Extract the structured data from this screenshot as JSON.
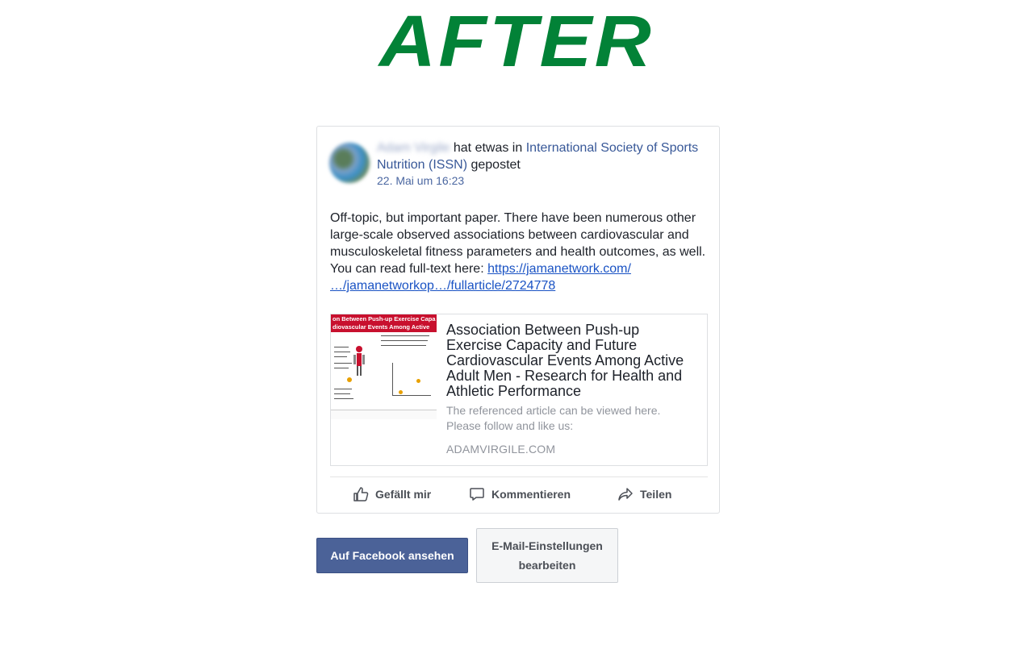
{
  "heading": "AFTER",
  "post": {
    "author_name": "Adam Virgile",
    "action_text": "hat etwas in",
    "group_name": "International Society of Sports Nutrition (ISSN)",
    "action_suffix": "gepostet",
    "timestamp": "22. Mai um 16:23",
    "body": "Off-topic, but important paper. There have been numerous other large-scale observed associations between cardiovascular and musculoskeletal fitness parameters and health outcomes, as well. You can read full-text here: ",
    "link_line1": "https://jamanetwork.com/",
    "link_line2": "…/jamanetworkop…/fullarticle/2724778"
  },
  "preview": {
    "thumb_banner": "on Between Push-up Exercise Capa\ndiovascular Events Among Active",
    "title": "Association Between Push-up Exercise Capacity and Future Cardiovascular Events Among Active Adult Men - Research for Health and Athletic Performance",
    "description": "The referenced article can be viewed here. Please follow and like us:",
    "domain": "ADAMVIRGILE.COM"
  },
  "actions": {
    "like": "Gefällt mir",
    "comment": "Kommentieren",
    "share": "Teilen"
  },
  "buttons": {
    "view_on_facebook": "Auf Facebook ansehen",
    "email_settings": "E-Mail-Einstellungen bearbeiten"
  },
  "colors": {
    "heading": "#028237",
    "link": "#385898",
    "primary_button": "#4b6298"
  }
}
